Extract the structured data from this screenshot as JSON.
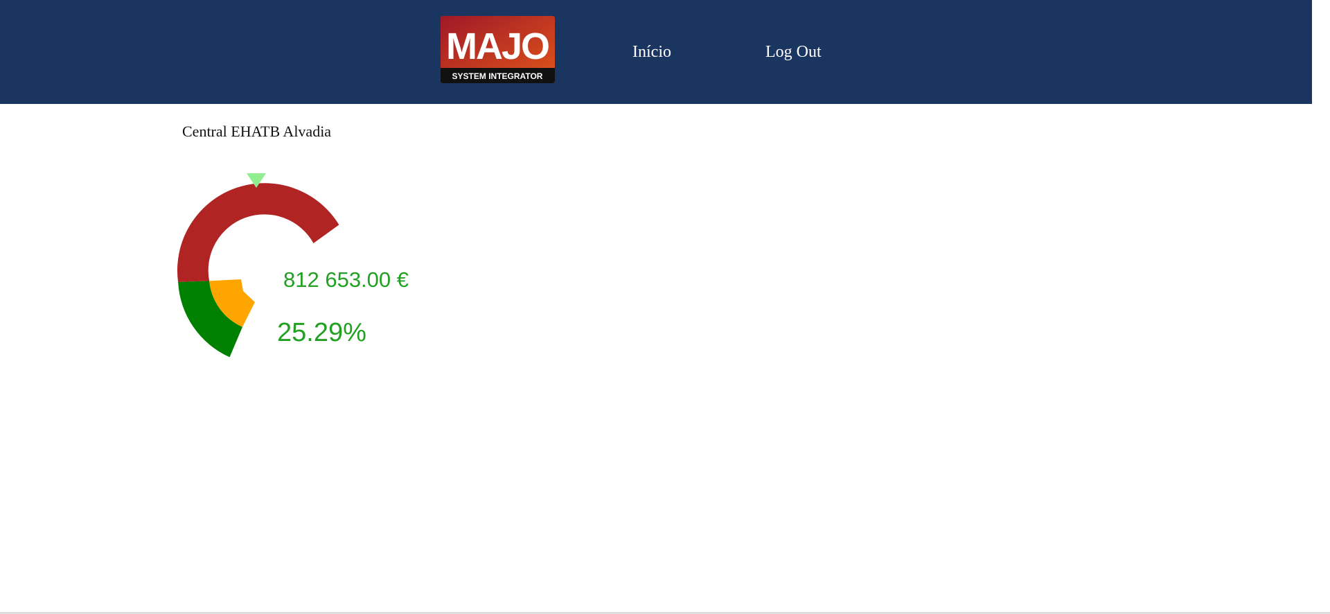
{
  "header": {
    "logo": {
      "text": "MAJO",
      "subtext": "SYSTEM INTEGRATOR",
      "colors": {
        "top": "#a01828",
        "bottom": "#d44a10",
        "band": "#111111"
      }
    },
    "nav": [
      {
        "label": "Início"
      },
      {
        "label": "Log Out"
      }
    ],
    "background": "#1b3561"
  },
  "main": {
    "title": "Central EHATB Alvadia"
  },
  "gauge": {
    "amount_text": "812 653.00 €",
    "percent_text": "25.29%",
    "value_percent": 25.29,
    "marker_color": "#90ee90",
    "text_color": "#22a022",
    "colors": {
      "outer_red": "#b02424",
      "outer_green": "#008000",
      "inner_orange": "#ffa500"
    }
  }
}
